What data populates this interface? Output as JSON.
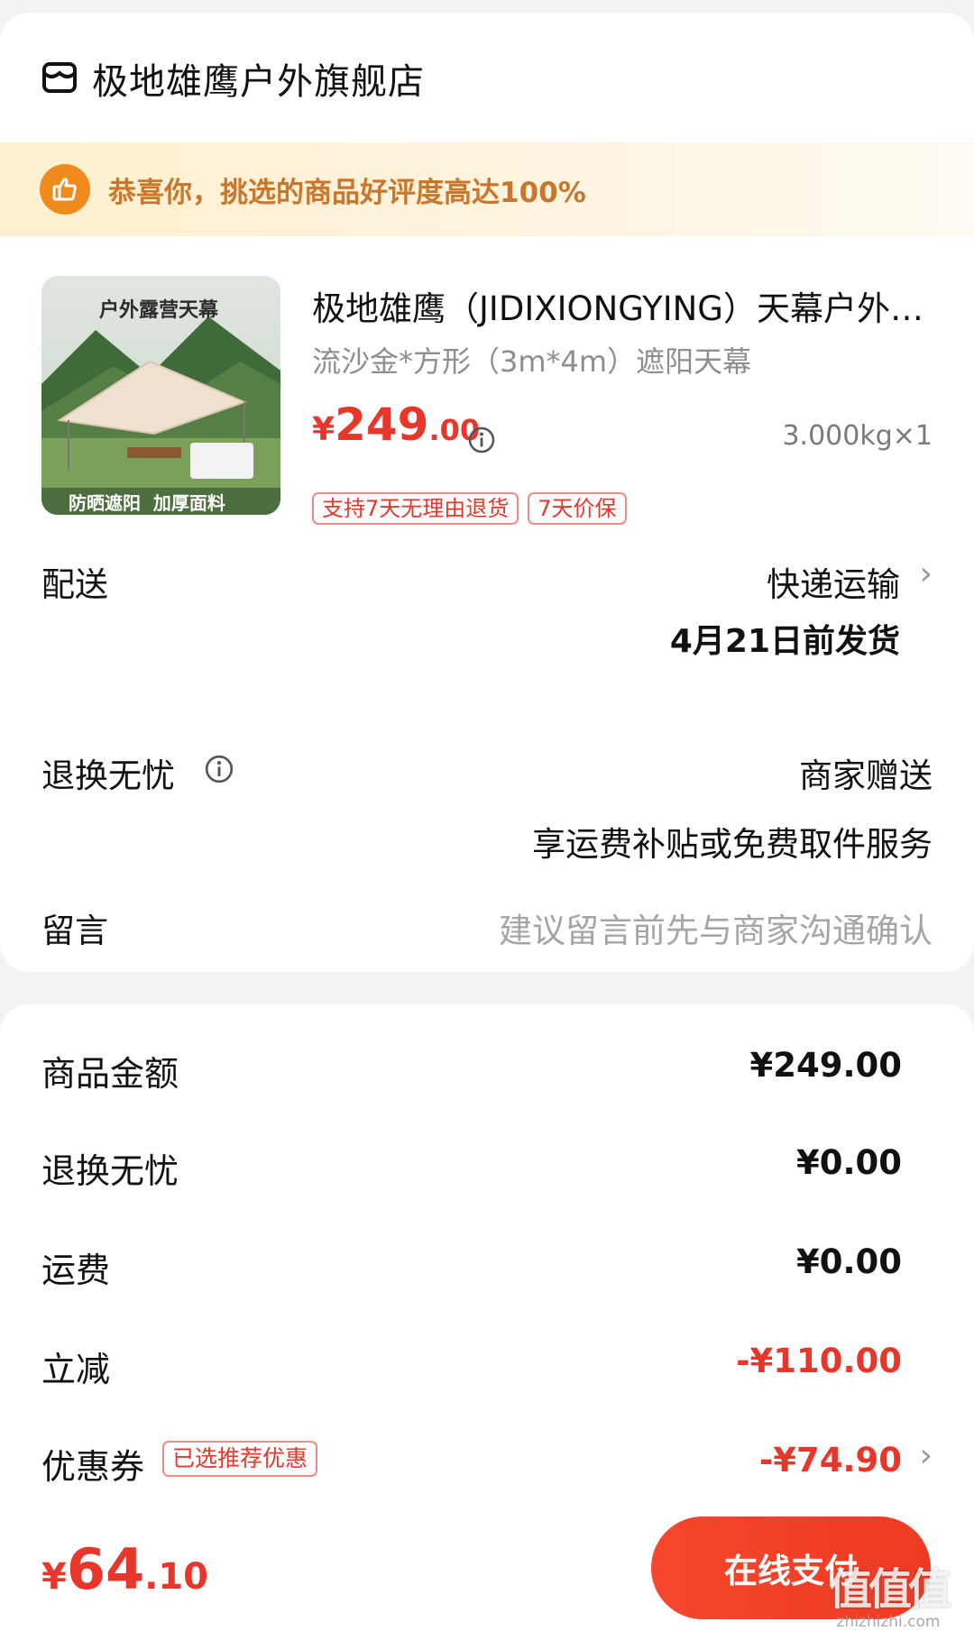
{
  "store": {
    "name": "极地雄鹰户外旗舰店"
  },
  "banner": {
    "text": "恭喜你，挑选的商品好评度高达100%"
  },
  "product": {
    "thumb_caption_top": "户外露营天幕",
    "thumb_caption_bottom": "防晒遮阳  加厚面料",
    "title": "极地雄鹰（JIDIXIONGYING）天幕户外露营",
    "sku": "流沙金*方形（3m*4m）遮阳天幕",
    "price_symbol": "¥",
    "price_integer": "249",
    "price_decimal": ".00",
    "weight_qty": "3.000kg×1",
    "tags": [
      "支持7天无理由退货",
      "7天价保"
    ]
  },
  "delivery": {
    "label": "配送",
    "method": "快递运输",
    "ship_date": "4月21日前发货"
  },
  "returns": {
    "label": "退换无忧",
    "value": "商家赠送",
    "desc": "享运费补贴或免费取件服务"
  },
  "message": {
    "label": "留言",
    "placeholder": "建议留言前先与商家沟通确认"
  },
  "summary": {
    "goods_label": "商品金额",
    "goods_value": "¥249.00",
    "returns_label": "退换无忧",
    "returns_value": "¥0.00",
    "shipping_label": "运费",
    "shipping_value": "¥0.00",
    "discount_label": "立减",
    "discount_value": "-¥110.00",
    "coupon_label": "优惠券",
    "coupon_tag": "已选推荐优惠",
    "coupon_value": "-¥74.90"
  },
  "footer": {
    "total_symbol": "¥",
    "total_integer": "64",
    "total_decimal": ".10",
    "pay_label": "在线支付",
    "watermark_logo": "值值值",
    "watermark_site": "zhizhizhi.com"
  },
  "colors": {
    "accent": "#e8362a",
    "banner_icon": "#ef8a1d",
    "banner_text": "#c9772b"
  }
}
